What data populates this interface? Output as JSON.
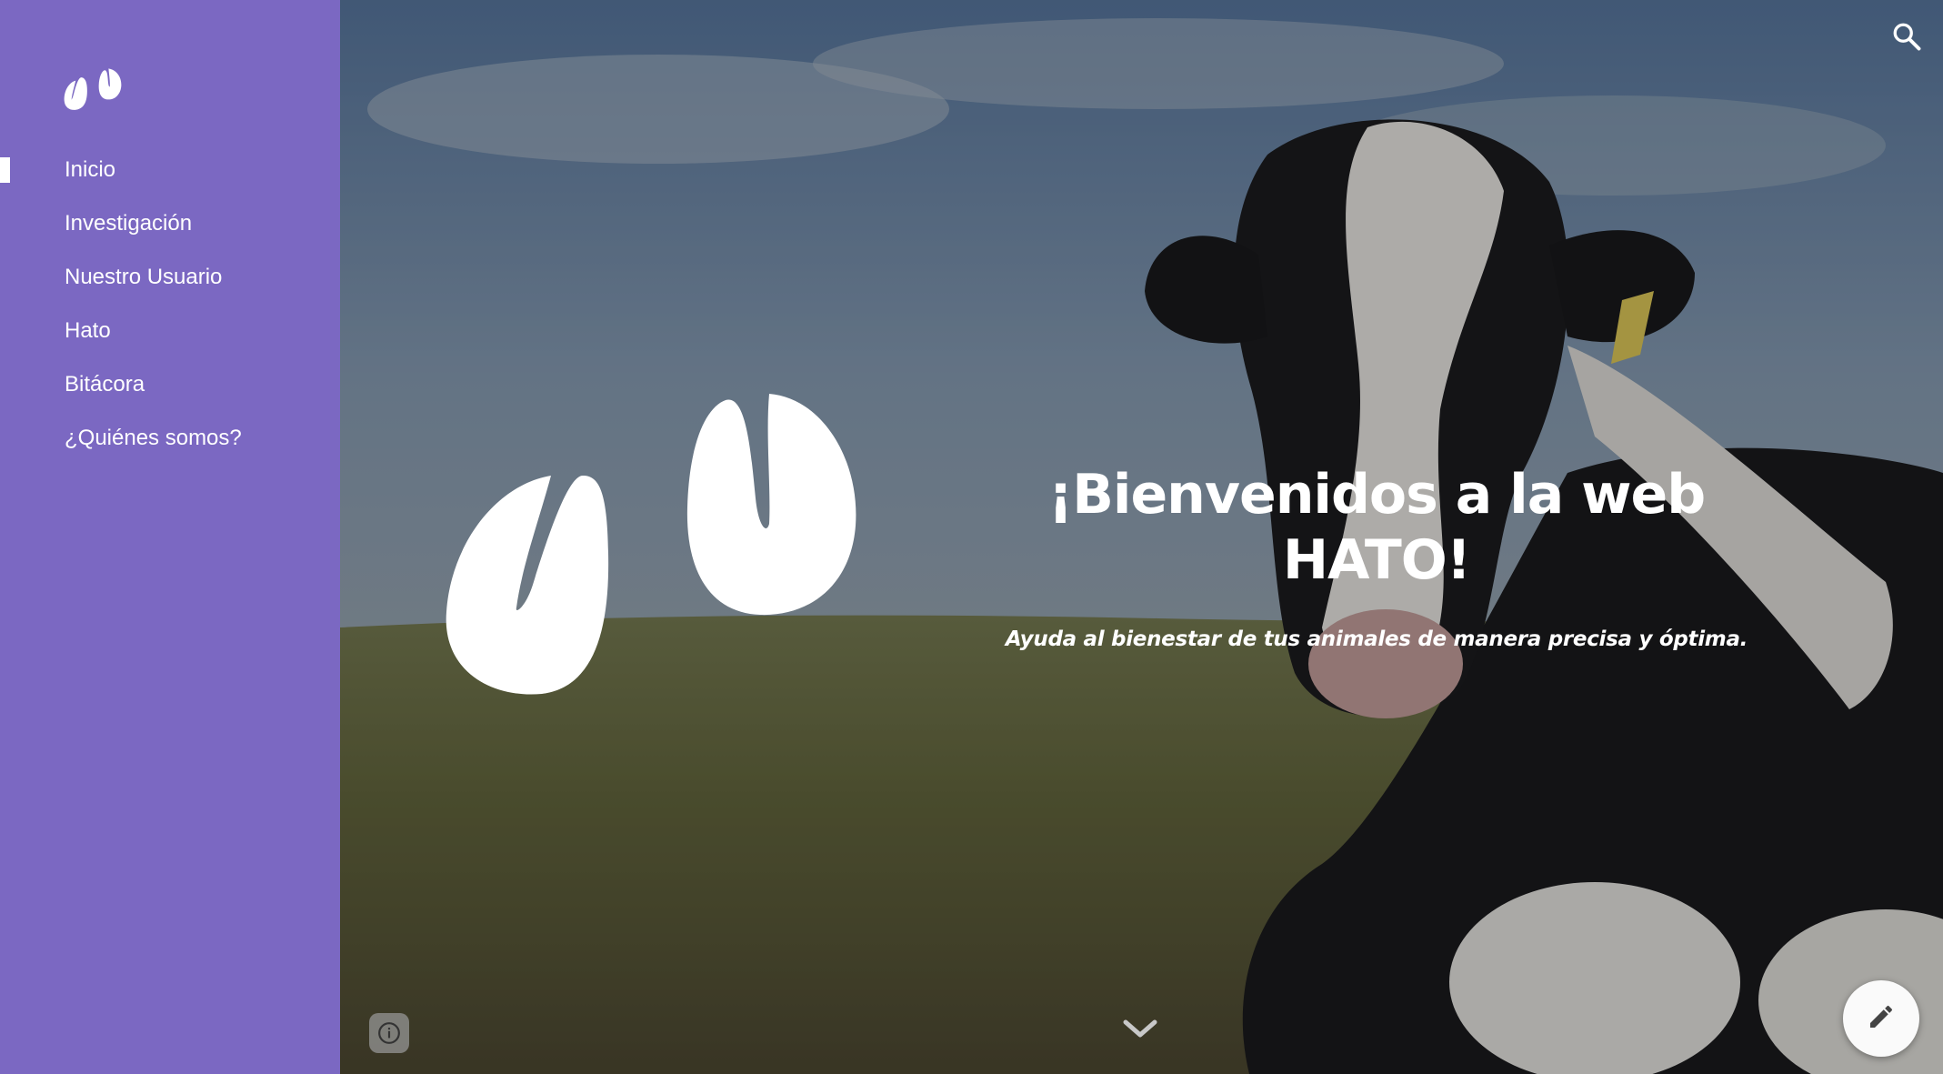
{
  "nav": {
    "items": [
      {
        "label": "Inicio",
        "active": true
      },
      {
        "label": "Investigación",
        "active": false
      },
      {
        "label": "Nuestro Usuario",
        "active": false
      },
      {
        "label": "Hato",
        "active": false
      },
      {
        "label": "Bitácora",
        "active": false
      },
      {
        "label": "¿Quiénes somos?",
        "active": false
      }
    ]
  },
  "hero": {
    "title": "¡Bienvenidos a la web HATO!",
    "subtitle": "Ayuda al bienestar de tus animales de manera precisa y óptima."
  },
  "icons": {
    "logo": "hoof-logo-icon",
    "search": "search-icon",
    "info": "info-icon",
    "scroll": "chevron-down-icon",
    "edit": "pencil-icon"
  },
  "colors": {
    "sidebar": "#7b68c2",
    "text": "#ffffff"
  }
}
